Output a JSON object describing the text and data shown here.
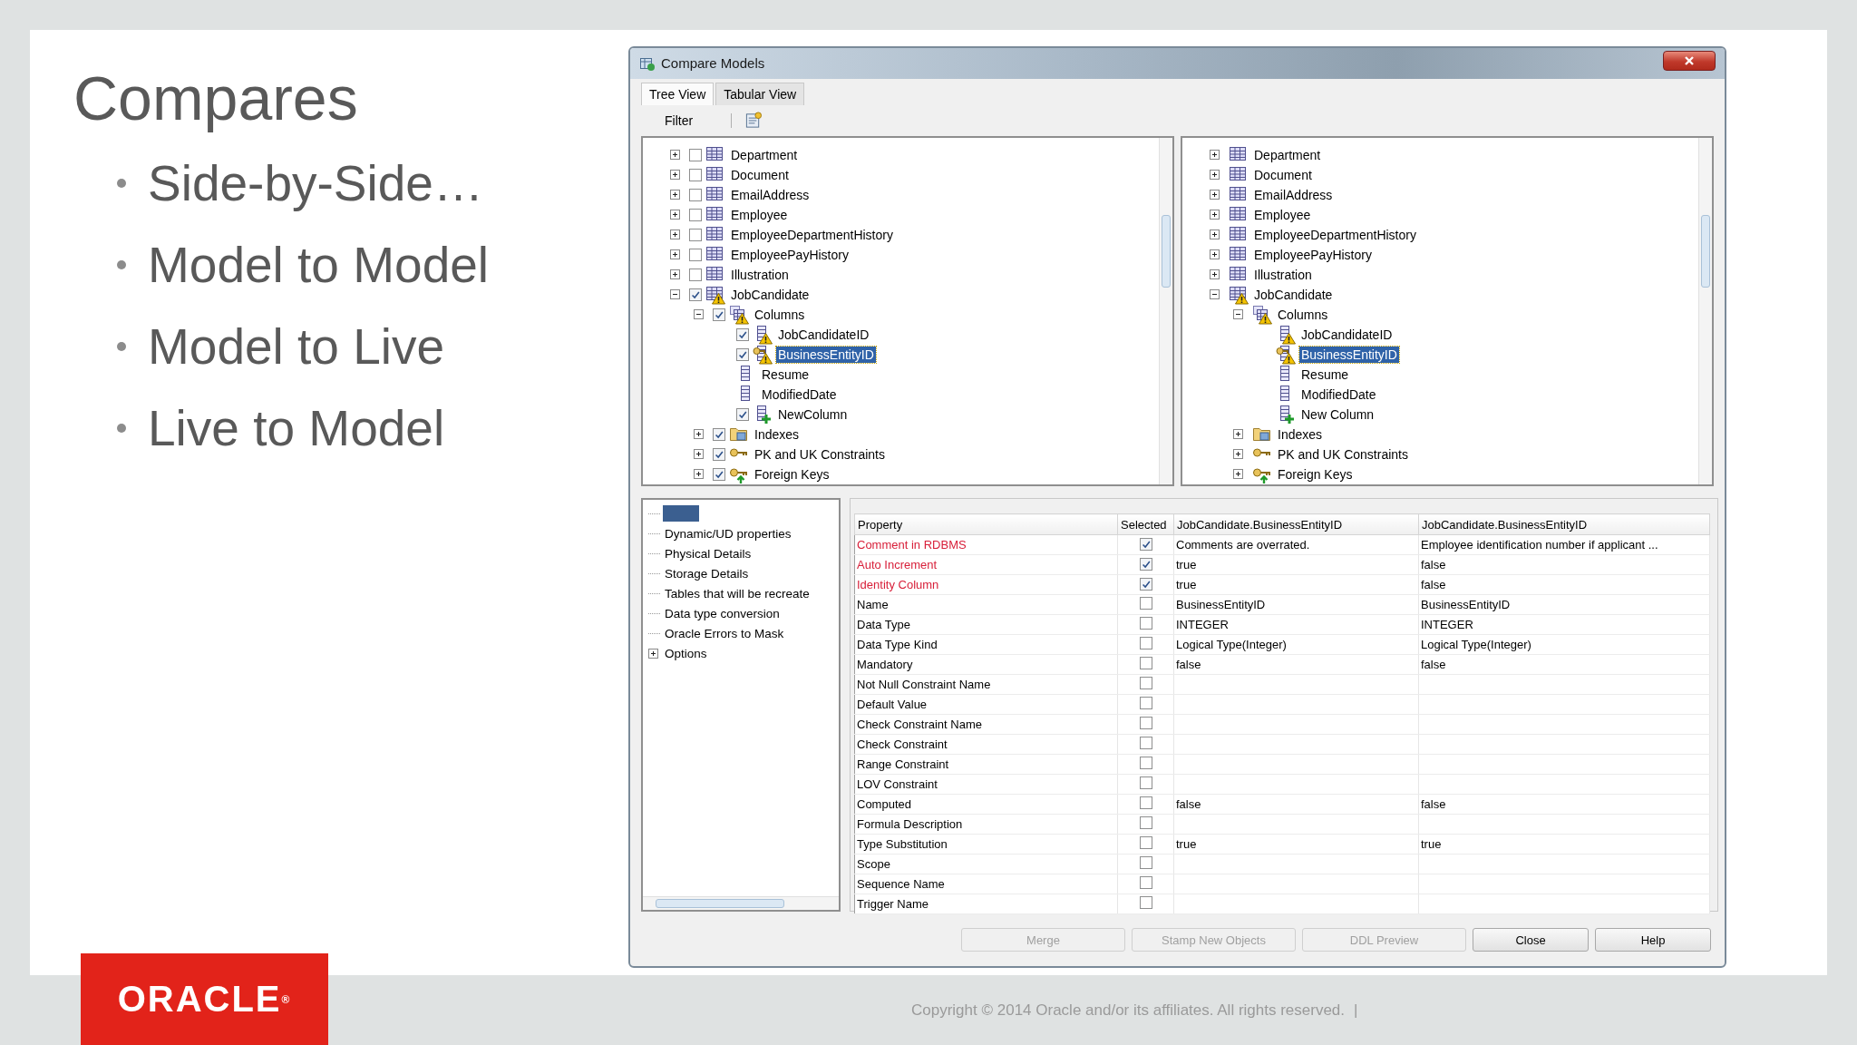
{
  "slide": {
    "title": "Compares",
    "bullets": [
      "Side-by-Side…",
      "Model to Model",
      "Model to Live",
      "Live to Model"
    ]
  },
  "window": {
    "title": "Compare Models"
  },
  "tabs": [
    {
      "label": "Tree View",
      "selected": true
    },
    {
      "label": "Tabular View",
      "selected": false
    }
  ],
  "toolbar": {
    "filter": "Filter"
  },
  "left_tree": [
    {
      "label": "Department",
      "kind": "table",
      "warning": false,
      "expanded": false,
      "checked": false,
      "selected": false
    },
    {
      "label": "Document",
      "kind": "table",
      "warning": false,
      "expanded": false,
      "checked": false,
      "selected": false
    },
    {
      "label": "EmailAddress",
      "kind": "table",
      "warning": false,
      "expanded": false,
      "checked": false,
      "selected": false
    },
    {
      "label": "Employee",
      "kind": "table",
      "warning": false,
      "expanded": false,
      "checked": false,
      "selected": false
    },
    {
      "label": "EmployeeDepartmentHistory",
      "kind": "table",
      "warning": false,
      "expanded": false,
      "checked": false,
      "selected": false
    },
    {
      "label": "EmployeePayHistory",
      "kind": "table",
      "warning": false,
      "expanded": false,
      "checked": false,
      "selected": false
    },
    {
      "label": "Illustration",
      "kind": "table",
      "warning": false,
      "expanded": false,
      "checked": false,
      "selected": false
    },
    {
      "label": "JobCandidate",
      "kind": "table",
      "warning": true,
      "expanded": true,
      "checked": true,
      "selected": false,
      "children": [
        {
          "label": "Columns",
          "kind": "columns",
          "warning": true,
          "expanded": true,
          "checked": true,
          "selected": false,
          "children": [
            {
              "label": "JobCandidateID",
              "kind": "column",
              "warning": true,
              "checked": true,
              "selected": false
            },
            {
              "label": "BusinessEntityID",
              "kind": "key_column",
              "warning": true,
              "checked": true,
              "selected": true
            },
            {
              "label": "Resume",
              "kind": "column",
              "warning": false,
              "selected": false
            },
            {
              "label": "ModifiedDate",
              "kind": "column",
              "warning": false,
              "selected": false
            },
            {
              "label": "NewColumn",
              "kind": "new_column",
              "warning": false,
              "checked": true,
              "selected": false
            }
          ]
        },
        {
          "label": "Indexes",
          "kind": "indexes",
          "warning": false,
          "expanded": false,
          "checked": true,
          "selected": false
        },
        {
          "label": "PK and UK Constraints",
          "kind": "keys",
          "warning": false,
          "expanded": false,
          "checked": true,
          "selected": false
        },
        {
          "label": "Foreign Keys",
          "kind": "foreign_keys",
          "warning": false,
          "expanded": false,
          "checked": true,
          "selected": false
        }
      ]
    }
  ],
  "right_tree": [
    {
      "label": "Department",
      "kind": "table",
      "warning": false,
      "expanded": false,
      "selected": false
    },
    {
      "label": "Document",
      "kind": "table",
      "warning": false,
      "expanded": false,
      "selected": false
    },
    {
      "label": "EmailAddress",
      "kind": "table",
      "warning": false,
      "expanded": false,
      "selected": false
    },
    {
      "label": "Employee",
      "kind": "table",
      "warning": false,
      "expanded": false,
      "selected": false
    },
    {
      "label": "EmployeeDepartmentHistory",
      "kind": "table",
      "warning": false,
      "expanded": false,
      "selected": false
    },
    {
      "label": "EmployeePayHistory",
      "kind": "table",
      "warning": false,
      "expanded": false,
      "selected": false
    },
    {
      "label": "Illustration",
      "kind": "table",
      "warning": false,
      "expanded": false,
      "selected": false
    },
    {
      "label": "JobCandidate",
      "kind": "table",
      "warning": true,
      "expanded": true,
      "selected": false,
      "children": [
        {
          "label": "Columns",
          "kind": "columns",
          "warning": true,
          "expanded": true,
          "selected": false,
          "children": [
            {
              "label": "JobCandidateID",
              "kind": "column",
              "warning": true,
              "selected": false
            },
            {
              "label": "BusinessEntityID",
              "kind": "key_column",
              "warning": true,
              "selected": true
            },
            {
              "label": "Resume",
              "kind": "column",
              "warning": false,
              "selected": false
            },
            {
              "label": "ModifiedDate",
              "kind": "column",
              "warning": false,
              "selected": false
            },
            {
              "label": "New Column",
              "kind": "new_column",
              "warning": false,
              "selected": false
            }
          ]
        },
        {
          "label": "Indexes",
          "kind": "indexes",
          "warning": false,
          "expanded": false,
          "selected": false
        },
        {
          "label": "PK and UK Constraints",
          "kind": "keys",
          "warning": false,
          "expanded": false,
          "selected": false
        },
        {
          "label": "Foreign Keys",
          "kind": "foreign_keys",
          "warning": false,
          "expanded": false,
          "selected": false
        }
      ]
    }
  ],
  "details_nav": [
    {
      "selected": true
    },
    {
      "label": "Dynamic/UD properties",
      "selected": false
    },
    {
      "label": "Physical Details",
      "selected": false
    },
    {
      "label": "Storage Details",
      "selected": false
    },
    {
      "label": "Tables that will be recreate",
      "selected": false
    },
    {
      "label": "Data type conversion",
      "selected": false
    },
    {
      "label": "Oracle Errors to Mask",
      "selected": false
    },
    {
      "label": "Options",
      "selected": false,
      "expanded": false
    }
  ],
  "properties": {
    "columns": [
      "Property",
      "Selected",
      "JobCandidate.BusinessEntityID",
      "JobCandidate.BusinessEntityID"
    ],
    "rows": [
      {
        "property": "Comment in RDBMS",
        "differs": true,
        "selected": true,
        "value_1": "Comments are overrated.",
        "value_2": "Employee identification number if applicant ..."
      },
      {
        "property": "Auto Increment",
        "differs": true,
        "selected": true,
        "value_1": "true",
        "value_2": "false"
      },
      {
        "property": "Identity Column",
        "differs": true,
        "selected": true,
        "value_1": "true",
        "value_2": "false"
      },
      {
        "property": "Name",
        "differs": false,
        "selected": false,
        "value_1": "BusinessEntityID",
        "value_2": "BusinessEntityID"
      },
      {
        "property": "Data Type",
        "differs": false,
        "selected": false,
        "value_1": "INTEGER",
        "value_2": "INTEGER"
      },
      {
        "property": "Data Type Kind",
        "differs": false,
        "selected": false,
        "value_1": "Logical Type(Integer)",
        "value_2": "Logical Type(Integer)"
      },
      {
        "property": "Mandatory",
        "differs": false,
        "selected": false,
        "value_1": "false",
        "value_2": "false"
      },
      {
        "property": "Not Null Constraint Name",
        "differs": false,
        "selected": false
      },
      {
        "property": "Default Value",
        "differs": false,
        "selected": false
      },
      {
        "property": "Check Constraint Name",
        "differs": false,
        "selected": false
      },
      {
        "property": "Check Constraint",
        "differs": false,
        "selected": false
      },
      {
        "property": "Range Constraint",
        "differs": false,
        "selected": false
      },
      {
        "property": "LOV Constraint",
        "differs": false,
        "selected": false
      },
      {
        "property": "Computed",
        "differs": false,
        "selected": false,
        "value_1": "false",
        "value_2": "false"
      },
      {
        "property": "Formula Description",
        "differs": false,
        "selected": false
      },
      {
        "property": "Type Substitution",
        "differs": false,
        "selected": false,
        "value_1": "true",
        "value_2": "true"
      },
      {
        "property": "Scope",
        "differs": false,
        "selected": false
      },
      {
        "property": "Sequence Name",
        "differs": false,
        "selected": false
      },
      {
        "property": "Trigger Name",
        "differs": false,
        "selected": false
      }
    ]
  },
  "buttons": [
    {
      "label": "Merge",
      "disabled": true
    },
    {
      "label": "Stamp New Objects",
      "disabled": true
    },
    {
      "label": "DDL Preview",
      "disabled": true
    },
    {
      "label": "Close",
      "disabled": false
    },
    {
      "label": "Help",
      "disabled": false
    }
  ],
  "footer": {
    "logo": "ORACLE$^{®}$",
    "copyright": "Copyright © 2014 Oracle and/or its affiliates. All rights reserved.",
    "separator": "|"
  }
}
